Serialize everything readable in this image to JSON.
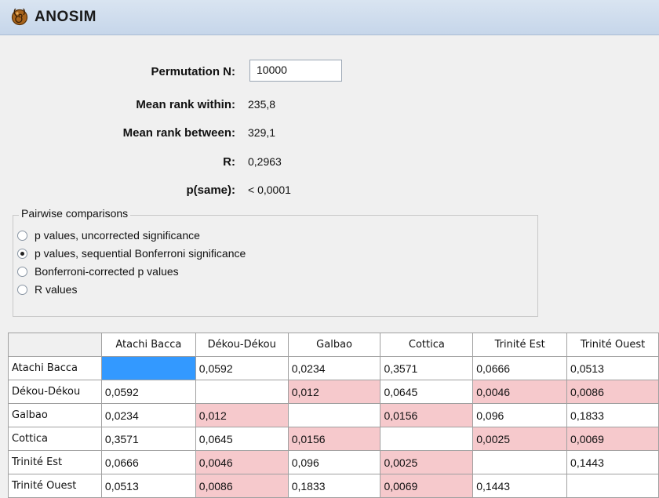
{
  "window": {
    "title": "ANOSIM",
    "icon": "ammonite-shell-icon"
  },
  "stats": {
    "permutation_label": "Permutation N:",
    "permutation_value": "10000",
    "mean_within_label": "Mean rank within:",
    "mean_within_value": "235,8",
    "mean_between_label": "Mean rank between:",
    "mean_between_value": "329,1",
    "r_label": "R:",
    "r_value": "0,2963",
    "psame_label": "p(same):",
    "psame_value": "< 0,0001"
  },
  "pairwise": {
    "legend": "Pairwise comparisons",
    "options": [
      {
        "label": "p values, uncorrected significance",
        "checked": false
      },
      {
        "label": "p values, sequential Bonferroni significance",
        "checked": true
      },
      {
        "label": "Bonferroni-corrected p values",
        "checked": false
      },
      {
        "label": "R values",
        "checked": false
      }
    ]
  },
  "matrix": {
    "columns": [
      "Atachi Bacca",
      "Dékou-Dékou",
      "Galbao",
      "Cottica",
      "Trinité Est",
      "Trinité Ouest"
    ],
    "rows": [
      {
        "name": "Atachi Bacca",
        "values": [
          "",
          "0,0592",
          "0,0234",
          "0,3571",
          "0,0666",
          "0,0513"
        ],
        "sig": [
          false,
          false,
          false,
          false,
          false,
          false
        ],
        "selected": 0
      },
      {
        "name": "Dékou-Dékou",
        "values": [
          "0,0592",
          "",
          "0,012",
          "0,0645",
          "0,0046",
          "0,0086"
        ],
        "sig": [
          false,
          false,
          true,
          false,
          true,
          true
        ]
      },
      {
        "name": "Galbao",
        "values": [
          "0,0234",
          "0,012",
          "",
          "0,0156",
          "0,096",
          "0,1833"
        ],
        "sig": [
          false,
          true,
          false,
          true,
          false,
          false
        ]
      },
      {
        "name": "Cottica",
        "values": [
          "0,3571",
          "0,0645",
          "0,0156",
          "",
          "0,0025",
          "0,0069"
        ],
        "sig": [
          false,
          false,
          true,
          false,
          true,
          true
        ]
      },
      {
        "name": "Trinité Est",
        "values": [
          "0,0666",
          "0,0046",
          "0,096",
          "0,0025",
          "",
          "0,1443"
        ],
        "sig": [
          false,
          true,
          false,
          true,
          false,
          false
        ]
      },
      {
        "name": "Trinité Ouest",
        "values": [
          "0,0513",
          "0,0086",
          "0,1833",
          "0,0069",
          "0,1443",
          ""
        ],
        "sig": [
          false,
          true,
          false,
          true,
          false,
          false
        ]
      }
    ],
    "colors": {
      "significant": "#f6c9cc",
      "selected": "#3399ff"
    }
  }
}
